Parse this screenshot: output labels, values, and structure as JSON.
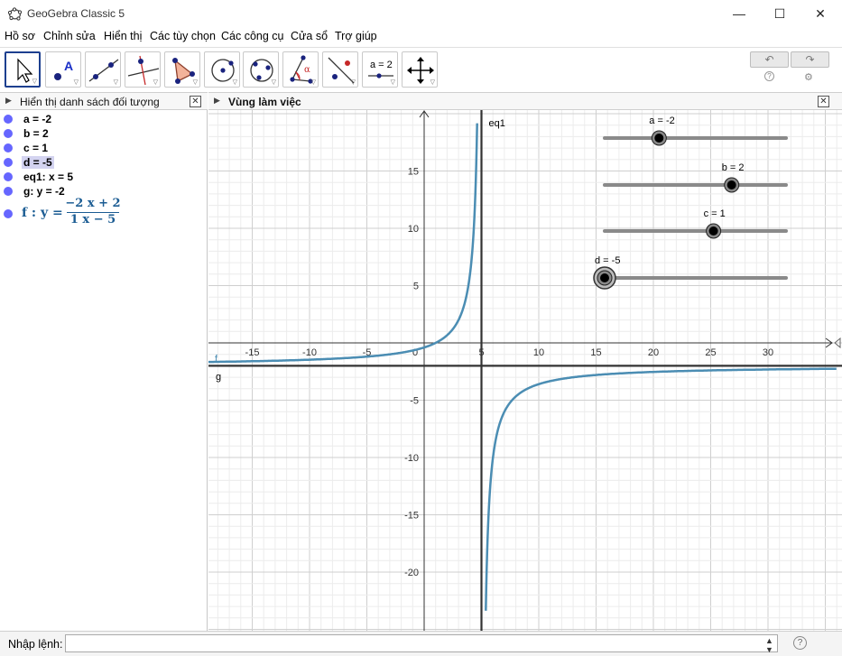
{
  "window": {
    "title": "GeoGebra Classic 5"
  },
  "menu": [
    "Hồ sơ",
    "Chỉnh sửa",
    "Hiển thị",
    "Các tùy chọn",
    "Các công cụ",
    "Cửa sổ",
    "Trợ giúp"
  ],
  "toolbar": {
    "tools": [
      {
        "name": "move-tool",
        "icon": "arrow-cursor-icon"
      },
      {
        "name": "point-tool",
        "icon": "point-icon",
        "text": "A"
      },
      {
        "name": "line-tool",
        "icon": "line-icon"
      },
      {
        "name": "perpendicular-tool",
        "icon": "perpendicular-icon"
      },
      {
        "name": "polygon-tool",
        "icon": "polygon-icon"
      },
      {
        "name": "circle-tool",
        "icon": "circle-icon"
      },
      {
        "name": "circle-3pt-tool",
        "icon": "circle-three-points-icon"
      },
      {
        "name": "angle-tool",
        "icon": "angle-icon",
        "text": "α"
      },
      {
        "name": "reflect-tool",
        "icon": "reflect-icon"
      },
      {
        "name": "slider-tool",
        "icon": "slider-icon",
        "text": "a = 2"
      },
      {
        "name": "move-view-tool",
        "icon": "move-graphics-icon"
      }
    ],
    "undo": "↶",
    "redo": "↷",
    "help": "?",
    "settings": "⚙"
  },
  "algebra": {
    "title": "Hiển thị danh sách đối tượng",
    "items": [
      {
        "label": "a = -2",
        "highlight": false
      },
      {
        "label": "b = 2",
        "highlight": false
      },
      {
        "label": "c = 1",
        "highlight": false
      },
      {
        "label": "d = -5",
        "highlight": true
      },
      {
        "label": "eq1: x = 5",
        "highlight": false
      },
      {
        "label": "g: y = -2",
        "highlight": false
      }
    ],
    "function": {
      "prefix": "f : y =",
      "numerator": "−2 x + 2",
      "denominator": "1 x − 5"
    }
  },
  "graphics": {
    "title": "Vùng làm việc",
    "curve_color": "#4b8db3",
    "line_color": "#333333",
    "labels": {
      "eq1": "eq1",
      "f": "f",
      "g": "g"
    },
    "x_ticks": [
      "-15",
      "-10",
      "-5",
      "0",
      "5",
      "10",
      "15",
      "20",
      "25",
      "30"
    ],
    "y_ticks": [
      "15",
      "10",
      "5",
      "-5",
      "-10",
      "-15",
      "-20"
    ],
    "sliders": [
      {
        "label": "a = -2",
        "value": -2,
        "min": -5,
        "max": 5
      },
      {
        "label": "b = 2",
        "value": 2,
        "min": -5,
        "max": 5
      },
      {
        "label": "c = 1",
        "value": 1,
        "min": -5,
        "max": 5
      },
      {
        "label": "d = -5",
        "value": -5,
        "min": -5,
        "max": 5
      }
    ]
  },
  "input": {
    "label": "Nhập lệnh:",
    "value": "",
    "help": "?"
  }
}
